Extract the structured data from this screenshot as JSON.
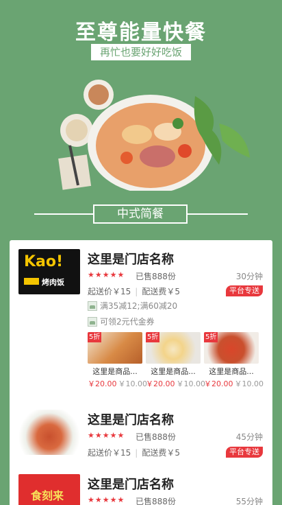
{
  "header": {
    "title": "至尊能量快餐",
    "subtitle": "再忙也要好好吃饭"
  },
  "section": {
    "title": "中式简餐"
  },
  "stores": [
    {
      "name": "这里是门店名称",
      "rating": "★★★★★",
      "sold": "已售888份",
      "time": "30分钟",
      "min_order": "起送价￥15",
      "delivery_fee": "配送费￥5",
      "badge": "平台专送",
      "logo_text": "Kao!",
      "logo_sub": "烤肉饭",
      "promos": [
        "满35减12;满60减20",
        "可领2元代金券"
      ],
      "products": [
        {
          "badge": "5折",
          "name": "这里是商品...",
          "price": "￥20.00",
          "old_price": "￥10.00"
        },
        {
          "badge": "5折",
          "name": "这里是商品...",
          "price": "￥20.00",
          "old_price": "￥10.00"
        },
        {
          "badge": "5折",
          "name": "这里是商品...",
          "price": "￥20.00",
          "old_price": "￥10.00"
        }
      ]
    },
    {
      "name": "这里是门店名称",
      "rating": "★★★★★",
      "sold": "已售888份",
      "time": "45分钟",
      "min_order": "起送价￥15",
      "delivery_fee": "配送费￥5",
      "badge": "平台专送"
    },
    {
      "name": "这里是门店名称",
      "rating": "★★★★★",
      "sold": "已售888份",
      "time": "55分钟",
      "logo_text": "食刻来"
    }
  ],
  "colors": {
    "brand_green": "#6aa472",
    "accent_red": "#e8383d"
  }
}
